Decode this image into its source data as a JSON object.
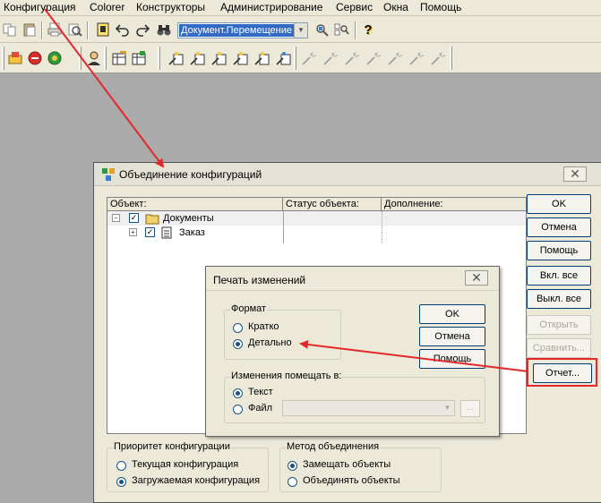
{
  "menubar": {
    "items": [
      "Конфигурация",
      "Colorer",
      "Конструкторы",
      "Администрирование",
      "Сервис",
      "Окна",
      "Помощь"
    ]
  },
  "toolbar": {
    "document_selector_value": "Документ.Перемещение",
    "help_glyph": "?"
  },
  "merge_dialog": {
    "title": "Объединение конфигураций",
    "close_glyph": "✕",
    "tree": {
      "columns": [
        "Объект:",
        "Статус объекта:",
        "Дополнение:"
      ],
      "rows": [
        {
          "label": "Документы",
          "checked": true
        },
        {
          "label": "Заказ",
          "checked": true
        }
      ],
      "expand_glyph": "−",
      "collapse_glyph": "+"
    },
    "buttons": {
      "ok": "OK",
      "cancel": "Отмена",
      "help": "Помощь",
      "select_all": "Вкл. все",
      "deselect_all": "Выкл. все",
      "open": "Открыть",
      "compare": "Сравнить...",
      "report": "Отчет..."
    },
    "priority_group": {
      "label": "Приоритет конфигурации",
      "options": [
        "Текущая конфигурация",
        "Загружаемая конфигурация"
      ],
      "selected": 1
    },
    "method_group": {
      "label": "Метод объединения",
      "options": [
        "Замещать объекты",
        "Объединять объекты"
      ],
      "selected": 0
    }
  },
  "print_dialog": {
    "title": "Печать изменений",
    "close_glyph": "✕",
    "format_group": {
      "label": "Формат",
      "options": [
        "Кратко",
        "Детально"
      ],
      "selected": 1
    },
    "output_group": {
      "label": "Изменения помещать в:",
      "options": [
        "Текст",
        "Файл"
      ],
      "selected": 0,
      "file_browse_label": "..."
    },
    "buttons": {
      "ok": "OK",
      "cancel": "Отмена",
      "help": "Помощь"
    }
  },
  "colors": {
    "annotation_red": "#e3282b",
    "selection_blue": "#316ac5",
    "dialog_face": "#ece9d8",
    "desktop": "#aaaaaa"
  }
}
